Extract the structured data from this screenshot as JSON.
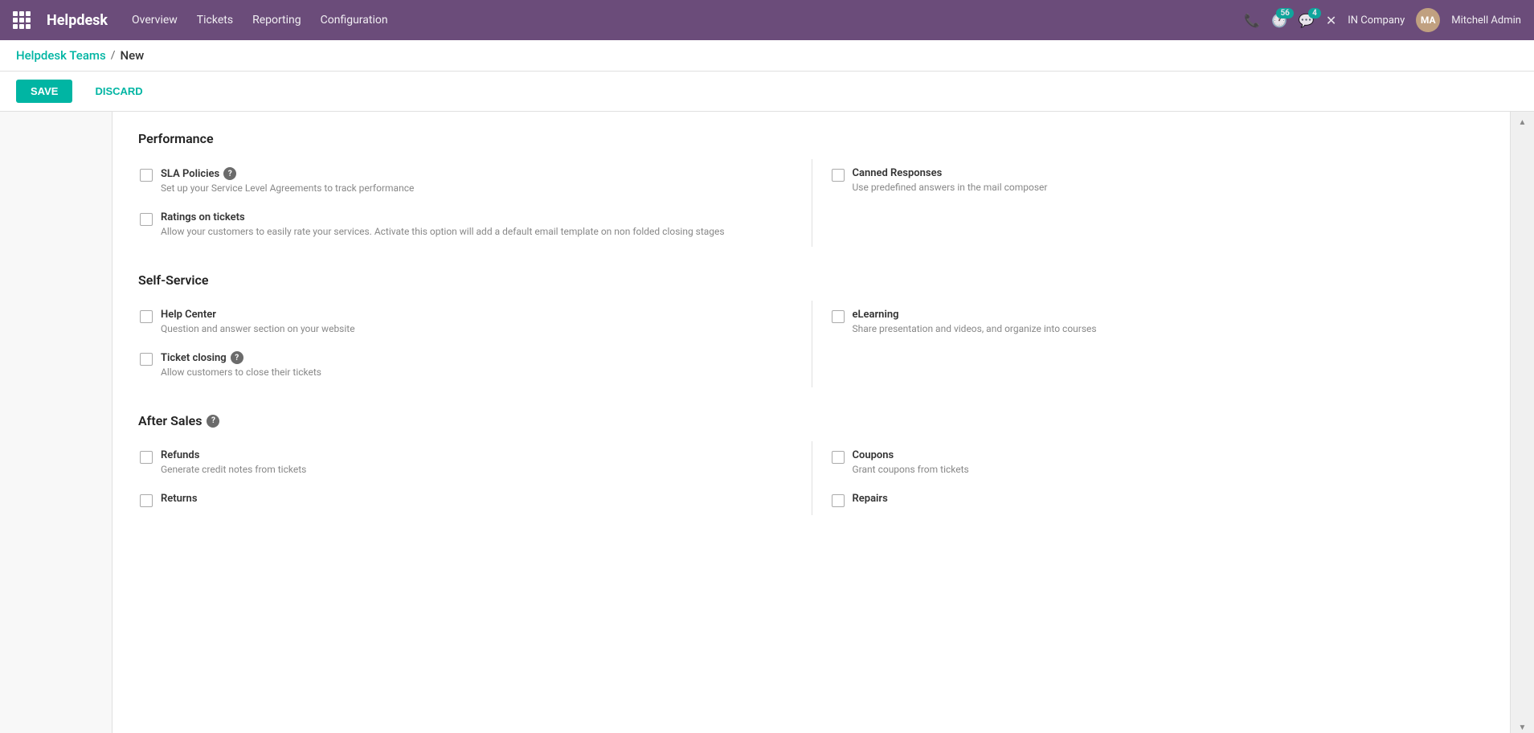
{
  "app": {
    "name": "Helpdesk"
  },
  "topnav": {
    "nav_items": [
      "Overview",
      "Tickets",
      "Reporting",
      "Configuration"
    ],
    "badge_56": "56",
    "badge_4": "4",
    "company": "IN Company",
    "user": "Mitchell Admin"
  },
  "breadcrumb": {
    "parent": "Helpdesk Teams",
    "separator": "/",
    "current": "New"
  },
  "actions": {
    "save_label": "SAVE",
    "discard_label": "DISCARD"
  },
  "sections": [
    {
      "id": "performance",
      "title": "Performance",
      "has_help": false,
      "options": [
        {
          "id": "sla-policies",
          "label": "SLA Policies",
          "has_help": true,
          "description": "Set up your Service Level Agreements to track performance",
          "col": "left"
        },
        {
          "id": "canned-responses",
          "label": "Canned Responses",
          "has_help": false,
          "description": "Use predefined answers in the mail composer",
          "col": "right"
        },
        {
          "id": "ratings-on-tickets",
          "label": "Ratings on tickets",
          "has_help": false,
          "description": "Allow your customers to easily rate your services. Activate this option will add a default email template on non folded closing stages",
          "col": "left"
        }
      ]
    },
    {
      "id": "self-service",
      "title": "Self-Service",
      "has_help": false,
      "options": [
        {
          "id": "help-center",
          "label": "Help Center",
          "has_help": false,
          "description": "Question and answer section on your website",
          "col": "left"
        },
        {
          "id": "elearning",
          "label": "eLearning",
          "has_help": false,
          "description": "Share presentation and videos, and organize into courses",
          "col": "right"
        },
        {
          "id": "ticket-closing",
          "label": "Ticket closing",
          "has_help": true,
          "description": "Allow customers to close their tickets",
          "col": "left"
        }
      ]
    },
    {
      "id": "after-sales",
      "title": "After Sales",
      "has_help": true,
      "options": [
        {
          "id": "refunds",
          "label": "Refunds",
          "has_help": false,
          "description": "Generate credit notes from tickets",
          "col": "left"
        },
        {
          "id": "coupons",
          "label": "Coupons",
          "has_help": false,
          "description": "Grant coupons from tickets",
          "col": "right"
        },
        {
          "id": "returns",
          "label": "Returns",
          "has_help": false,
          "description": "",
          "col": "left"
        },
        {
          "id": "repairs",
          "label": "Repairs",
          "has_help": false,
          "description": "",
          "col": "right"
        }
      ]
    }
  ],
  "help_icon_label": "?"
}
